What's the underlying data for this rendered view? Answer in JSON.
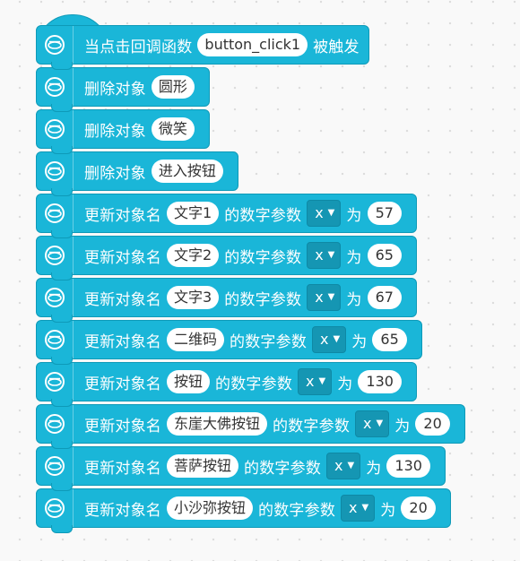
{
  "colors": {
    "block": "#1ab6d8",
    "block_border": "#0e9ab8",
    "dropdown": "#1596b3"
  },
  "icon": "screen-object-icon",
  "blocks": [
    {
      "parts": [
        {
          "text": "当点击回调函数"
        },
        {
          "field": "button_click1"
        },
        {
          "text": "被触发"
        }
      ]
    },
    {
      "parts": [
        {
          "text": "删除对象"
        },
        {
          "field": "圆形"
        }
      ]
    },
    {
      "parts": [
        {
          "text": "删除对象"
        },
        {
          "field": "微笑"
        }
      ]
    },
    {
      "parts": [
        {
          "text": "删除对象"
        },
        {
          "field": "进入按钮"
        }
      ]
    },
    {
      "parts": [
        {
          "text": "更新对象名"
        },
        {
          "field": "文字1"
        },
        {
          "text": "的数字参数"
        },
        {
          "dropdown": "x"
        },
        {
          "text": "为"
        },
        {
          "number": "57"
        }
      ]
    },
    {
      "parts": [
        {
          "text": "更新对象名"
        },
        {
          "field": "文字2"
        },
        {
          "text": "的数字参数"
        },
        {
          "dropdown": "x"
        },
        {
          "text": "为"
        },
        {
          "number": "65"
        }
      ]
    },
    {
      "parts": [
        {
          "text": "更新对象名"
        },
        {
          "field": "文字3"
        },
        {
          "text": "的数字参数"
        },
        {
          "dropdown": "x"
        },
        {
          "text": "为"
        },
        {
          "number": "67"
        }
      ]
    },
    {
      "parts": [
        {
          "text": "更新对象名"
        },
        {
          "field": "二维码"
        },
        {
          "text": "的数字参数"
        },
        {
          "dropdown": "x"
        },
        {
          "text": "为"
        },
        {
          "number": "65"
        }
      ]
    },
    {
      "parts": [
        {
          "text": "更新对象名"
        },
        {
          "field": "按钮"
        },
        {
          "text": "的数字参数"
        },
        {
          "dropdown": "x"
        },
        {
          "text": "为"
        },
        {
          "number": "130"
        }
      ]
    },
    {
      "parts": [
        {
          "text": "更新对象名"
        },
        {
          "field": "东崖大佛按钮"
        },
        {
          "text": "的数字参数"
        },
        {
          "dropdown": "x"
        },
        {
          "text": "为"
        },
        {
          "number": "20"
        }
      ]
    },
    {
      "parts": [
        {
          "text": "更新对象名"
        },
        {
          "field": "菩萨按钮"
        },
        {
          "text": "的数字参数"
        },
        {
          "dropdown": "x"
        },
        {
          "text": "为"
        },
        {
          "number": "130"
        }
      ]
    },
    {
      "parts": [
        {
          "text": "更新对象名"
        },
        {
          "field": "小沙弥按钮"
        },
        {
          "text": "的数字参数"
        },
        {
          "dropdown": "x"
        },
        {
          "text": "为"
        },
        {
          "number": "20"
        }
      ]
    }
  ]
}
